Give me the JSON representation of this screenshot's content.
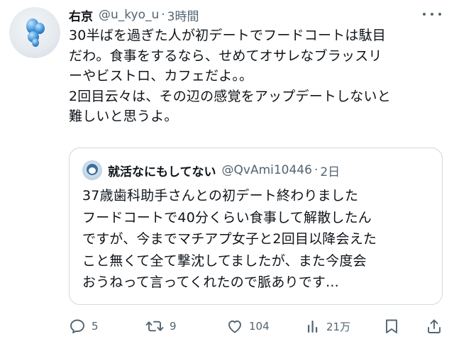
{
  "tweet": {
    "display_name": "右京",
    "handle": "@u_kyo_u",
    "separator": "·",
    "time": "3時間",
    "text_lines": [
      "30半ばを過ぎた人が初デートでフードコートは駄目",
      "だわ。食事をするなら、せめてオサレなブラッスリ",
      "ーやビストロ、カフェだよ。。",
      "2回目云々は、その辺の感覚をアップデートしないと",
      "難しいと思うよ。"
    ]
  },
  "quote": {
    "display_name": "就活なにもしてない",
    "handle": "@QvAmi10446",
    "separator": "·",
    "time": "2日",
    "text_lines": [
      "37歳歯科助手さんとの初デート終わりました",
      "フードコートで40分くらい食事して解散したん",
      "ですが、今までマチアプ女子と2回目以降会えた",
      "こと無くて全て撃沈してましたが、また今度会",
      "おうねって言ってくれたので脈ありです..."
    ]
  },
  "actions": {
    "reply_count": "5",
    "retweet_count": "9",
    "like_count": "104",
    "views_count": "21万"
  },
  "icons": {
    "reply": "reply-icon",
    "retweet": "retweet-icon",
    "like": "like-icon",
    "views": "views-icon",
    "bookmark": "bookmark-icon",
    "share": "share-icon",
    "more": "more-icon"
  },
  "colors": {
    "text": "#0f1419",
    "secondary": "#536471",
    "border": "#cfd9de"
  }
}
